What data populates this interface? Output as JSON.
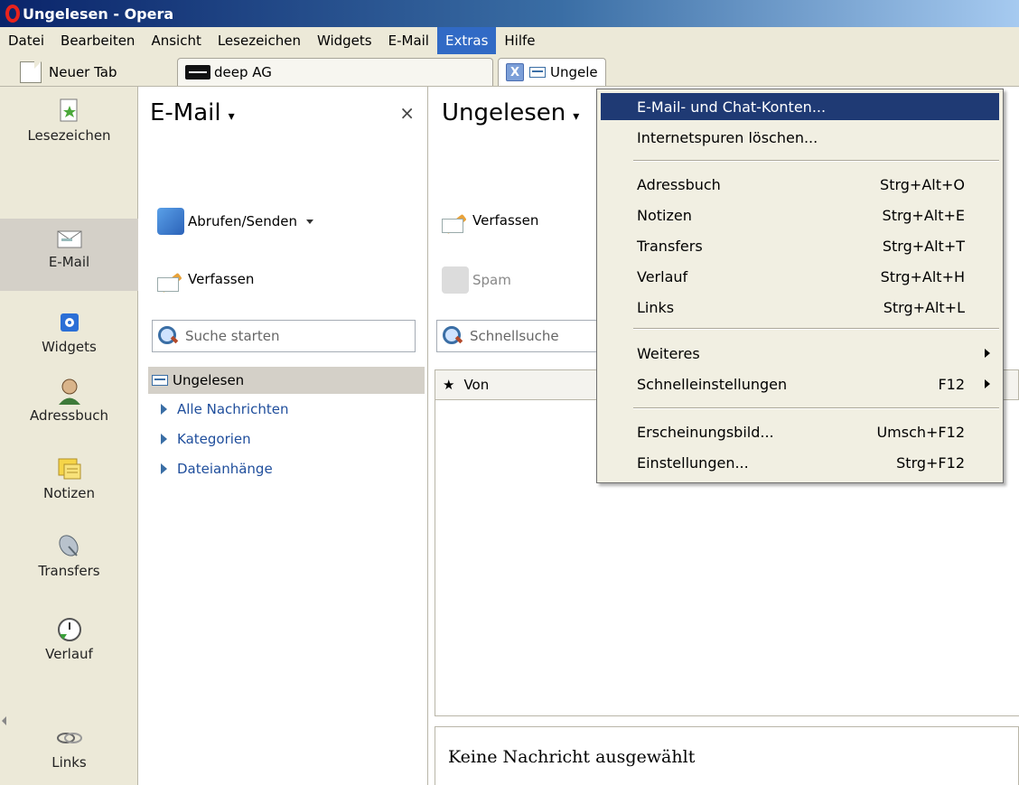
{
  "window": {
    "title": "Ungelesen - Opera"
  },
  "menubar": {
    "items": [
      "Datei",
      "Bearbeiten",
      "Ansicht",
      "Lesezeichen",
      "Widgets",
      "E-Mail",
      "Extras",
      "Hilfe"
    ],
    "active": "Extras"
  },
  "tabs": {
    "new_tab": "Neuer Tab",
    "deep": "deep AG",
    "ungelesen": "Ungele",
    "close_glyph": "X"
  },
  "panelbar": {
    "items": [
      "Lesezeichen",
      "E-Mail",
      "Widgets",
      "Adressbuch",
      "Notizen",
      "Transfers",
      "Verlauf",
      "Links"
    ],
    "active": "E-Mail"
  },
  "mailpanel": {
    "title": "E-Mail",
    "close": "×",
    "fetch_send": "Abrufen/Senden",
    "compose": "Verfassen",
    "search_placeholder": "Suche starten",
    "tree": {
      "selected": "Ungelesen",
      "children": [
        "Alle Nachrichten",
        "Kategorien",
        "Dateianhänge"
      ]
    }
  },
  "mainview": {
    "title": "Ungelesen",
    "compose": "Verfassen",
    "spam": "Spam",
    "quicksearch": "Schnellsuche",
    "column_from": "Von",
    "star": "★",
    "no_message": "Keine Nachricht ausgewählt"
  },
  "extras_menu": {
    "items": [
      {
        "label": "E-Mail- und Chat-Konten...",
        "accel": ""
      },
      {
        "label": "Internetspuren löschen...",
        "accel": ""
      },
      {
        "label": "Adressbuch",
        "accel": "Strg+Alt+O"
      },
      {
        "label": "Notizen",
        "accel": "Strg+Alt+E"
      },
      {
        "label": "Transfers",
        "accel": "Strg+Alt+T"
      },
      {
        "label": "Verlauf",
        "accel": "Strg+Alt+H"
      },
      {
        "label": "Links",
        "accel": "Strg+Alt+L"
      },
      {
        "label": "Weiteres",
        "accel": ""
      },
      {
        "label": "Schnelleinstellungen",
        "accel": "F12"
      },
      {
        "label": "Erscheinungsbild...",
        "accel": "Umsch+F12"
      },
      {
        "label": "Einstellungen...",
        "accel": "Strg+F12"
      }
    ]
  }
}
